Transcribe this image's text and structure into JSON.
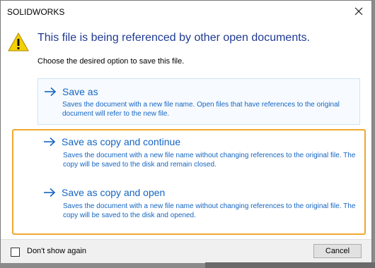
{
  "window": {
    "title": "SOLIDWORKS",
    "close_icon": "close-icon"
  },
  "message": {
    "icon": "warning-icon",
    "heading": "This file is being referenced by other open documents.",
    "subtext": "Choose the desired option to save this file."
  },
  "options": [
    {
      "title": "Save as",
      "description": "Saves the document with a new file name. Open files that have references to the original document will refer to the new file."
    },
    {
      "title": "Save as copy and continue",
      "description": "Saves the document with a new file name without changing references to the original file. The copy will be saved to the disk and remain closed."
    },
    {
      "title": "Save as copy and open",
      "description": "Saves the document with a new file name without changing references to the original file. The copy will be saved to the disk and opened."
    }
  ],
  "footer": {
    "dont_show_label": "Don't show again",
    "dont_show_checked": false,
    "cancel_label": "Cancel"
  },
  "colors": {
    "link_blue": "#1565c0",
    "heading_blue": "#1f3a93",
    "highlight_orange": "#f0a830",
    "warning_yellow": "#f5d000"
  }
}
